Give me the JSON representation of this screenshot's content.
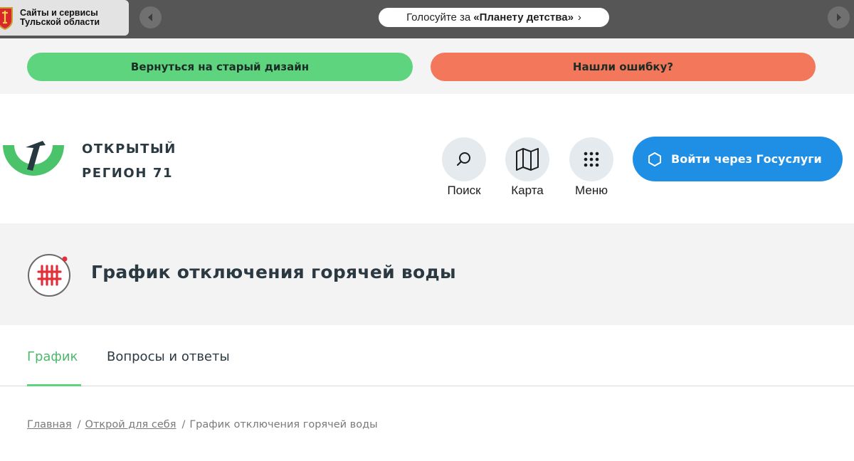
{
  "topbar": {
    "sites_label": "Сайты и сервисы\nТульской области",
    "promo_prefix": "Голосуйте за",
    "promo_bold": "«Планету детства»",
    "promo_chevron": "›"
  },
  "feedback": {
    "old_design_label": "Вернуться на старый дизайн",
    "found_error_label": "Нашли ошибку?"
  },
  "header": {
    "logo_line1": "ОТКРЫТЫЙ",
    "logo_line2": "РЕГИОН 71",
    "search_label": "Поиск",
    "map_label": "Карта",
    "menu_label": "Меню",
    "login_label": "Войти через Госуслуги"
  },
  "page": {
    "title": "График отключения горячей воды"
  },
  "tabs": [
    {
      "label": "График",
      "active": true
    },
    {
      "label": "Вопросы и ответы",
      "active": false
    }
  ],
  "breadcrumb": {
    "home": "Главная",
    "section": "Открой для себя",
    "current": "График отключения горячей воды",
    "separator": "/"
  },
  "colors": {
    "accent_green": "#5ed47f",
    "error_red": "#f2775b",
    "gosuslugi_blue": "#1f8fe6",
    "title_text": "#2b3a42"
  }
}
